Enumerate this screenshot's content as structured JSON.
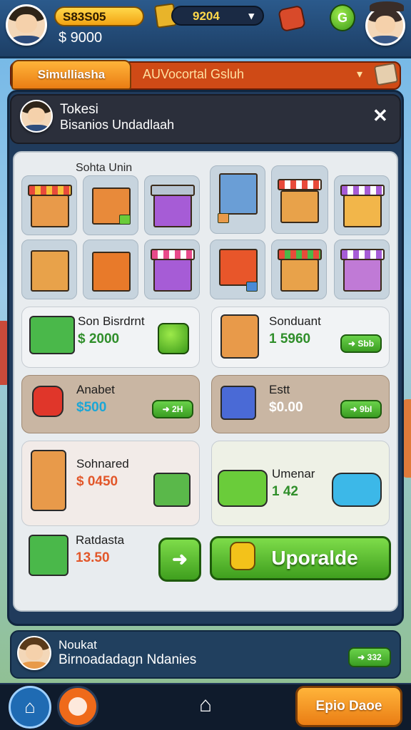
{
  "header": {
    "coins": "S83S05",
    "money": "$ 9000",
    "cash": "9204",
    "cash_chevron": "▾",
    "gem_label": "G"
  },
  "tabs": {
    "active_label": "Simulliasha",
    "title": "AUVocortal Gsluh",
    "chevron": "▾"
  },
  "panel": {
    "title": "Tokesi",
    "subtitle": "Bisanios Undadlaah",
    "close": "✕",
    "grid_label": "Sohta Unin"
  },
  "cards": [
    {
      "title": "Son Bisrdrnt",
      "price": "$ 2000",
      "price_color": "#2f8e2a"
    },
    {
      "title": "Sonduant",
      "price": "1 5960",
      "price_color": "#2f8e2a",
      "button": "➜ Sbb"
    },
    {
      "title": "Anabet",
      "price": "$500",
      "price_color": "#1ba6d6",
      "button": "➜ 2H"
    },
    {
      "title": "Estt",
      "price": "$0.00",
      "price_color": "#ffffff",
      "button": "➜ 9bI"
    },
    {
      "title": "Sohnared",
      "price": "$ 0450",
      "price_color": "#e2572a"
    },
    {
      "title": "Umenar",
      "price": "1 42",
      "price_color": "#2f8e2a"
    },
    {
      "title": "Ratdasta",
      "price": "13.50",
      "price_color": "#e2572a"
    }
  ],
  "actions": {
    "arrow": "➜",
    "upgrade": "Uporalde"
  },
  "notification": {
    "title": "Noukat",
    "subtitle": "Birnoadadagn Ndanies",
    "button": "➜ 332"
  },
  "bottom_nav": {
    "home_icon": "⌂",
    "home_outline": "⌂",
    "action_button": "Epio Daoe"
  },
  "colors": {
    "accent_orange": "#ea7d14",
    "accent_green": "#3f9f1e",
    "panel_dark": "#203b5c"
  }
}
